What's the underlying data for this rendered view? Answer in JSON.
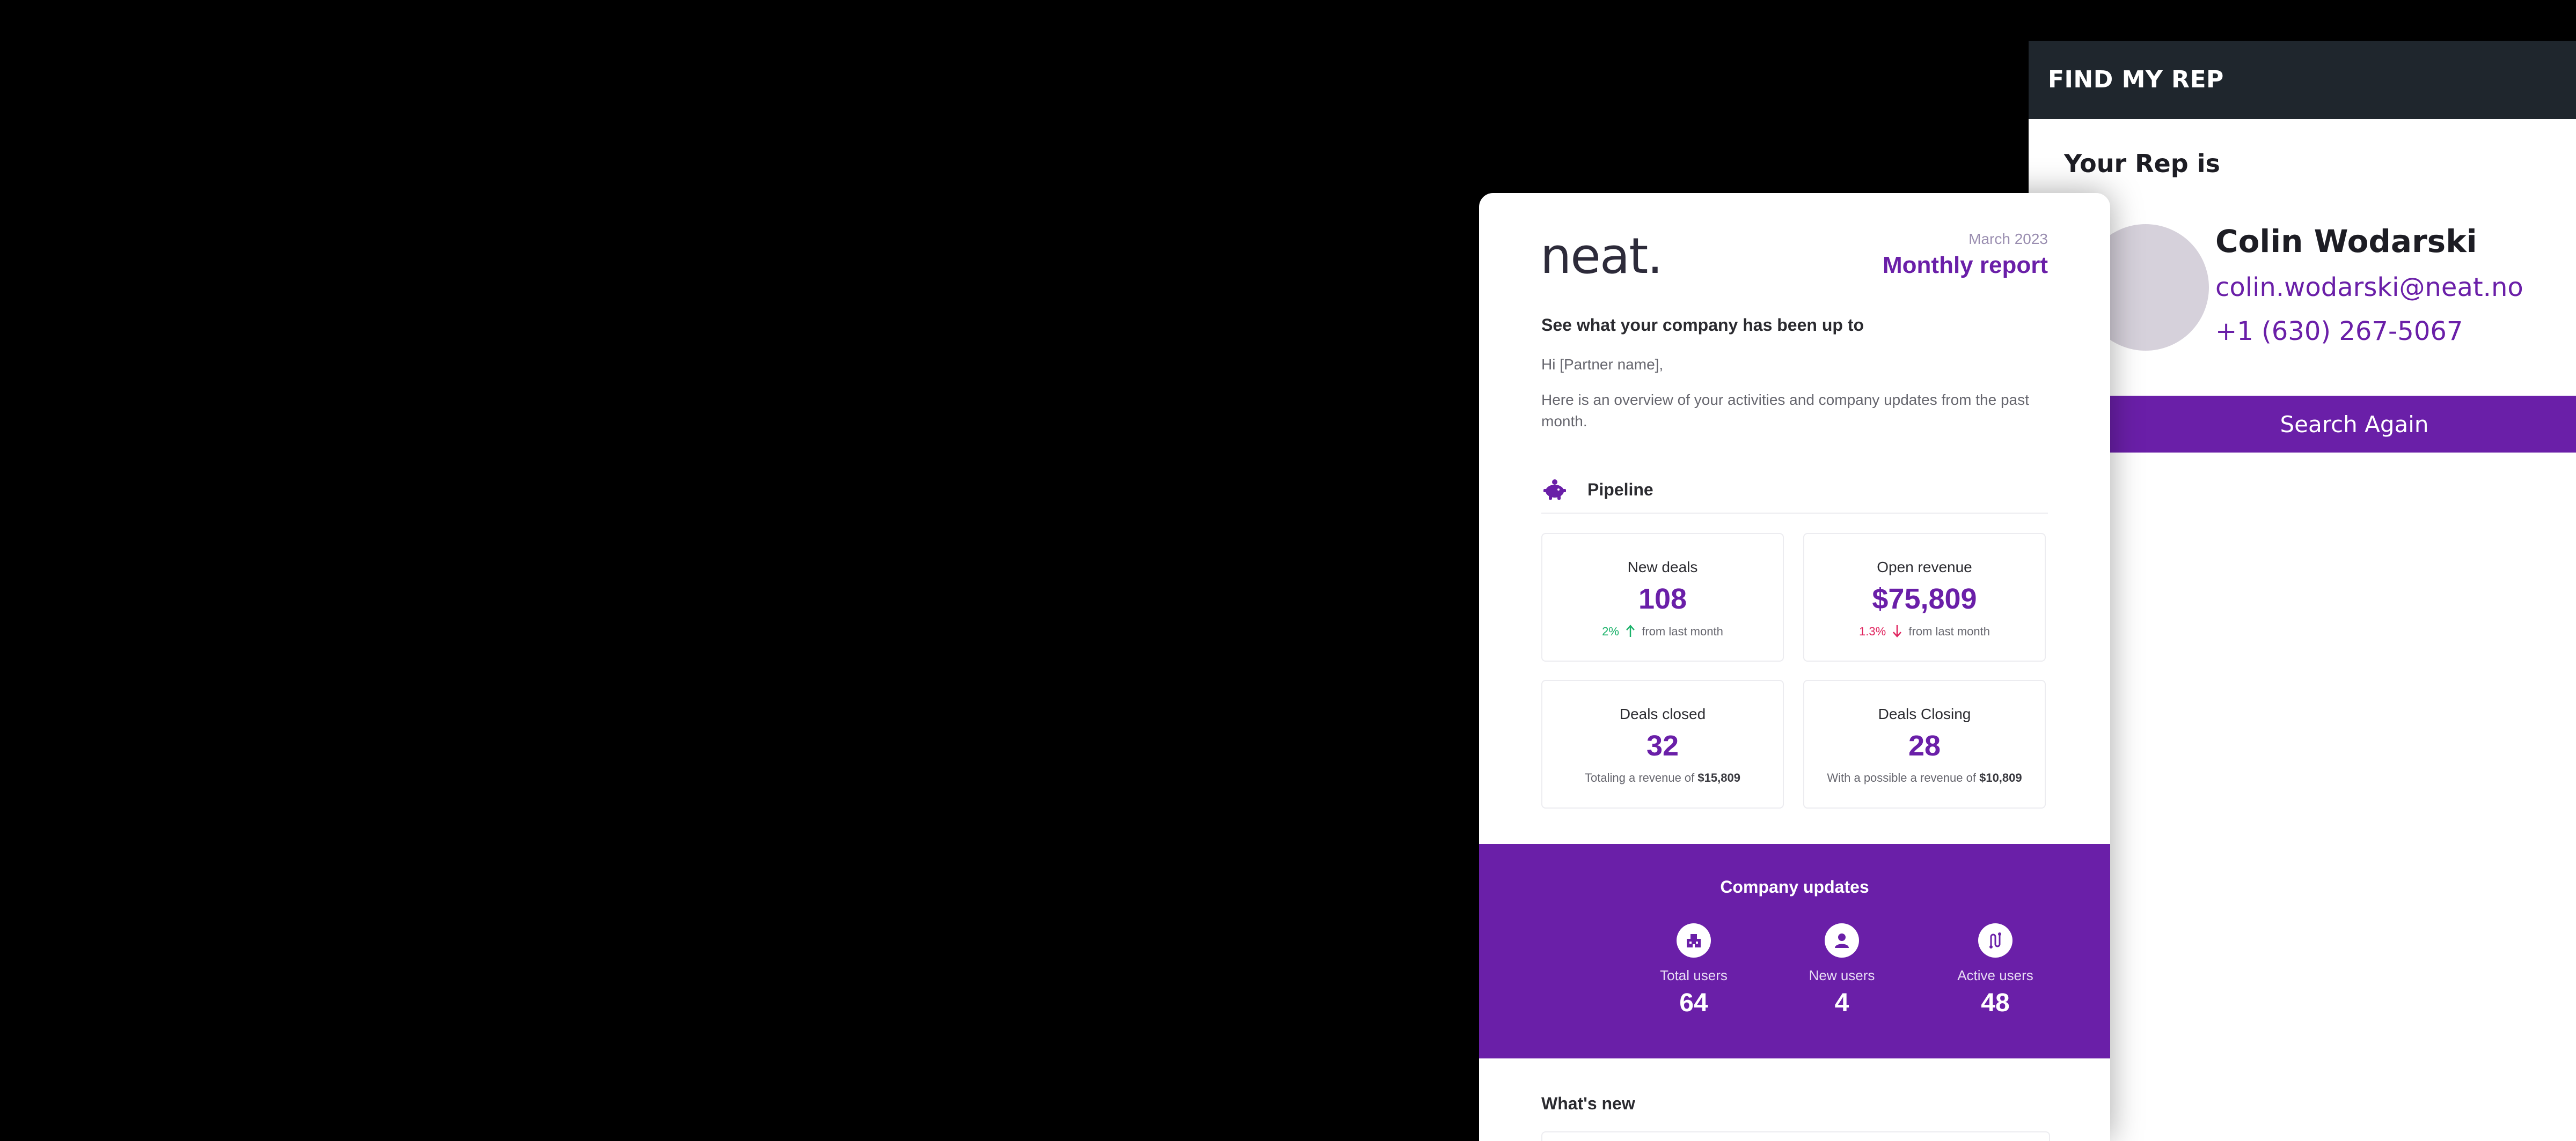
{
  "rep_panel": {
    "header": "FIND MY REP",
    "intro": "Your Rep is",
    "name": "Colin Wodarski",
    "email": "colin.wodarski@neat.no",
    "phone": "+1 (630) 267-5067",
    "button": "Search Again"
  },
  "report": {
    "logo_text": "neat.",
    "date": "March 2023",
    "title": "Monthly report",
    "heading": "See what your company has been up to",
    "greeting": "Hi [Partner name],",
    "overview": "Here is an overview of your activities and company updates from the past month.",
    "pipeline": {
      "label": "Pipeline",
      "icon": "piggy-bank-icon",
      "cards": [
        {
          "label": "New deals",
          "value": "108",
          "pct": "2%",
          "trend": "up",
          "suffix": "from last month"
        },
        {
          "label": "Open revenue",
          "value": "$75,809",
          "pct": "1.3%",
          "trend": "down",
          "suffix": "from last month"
        },
        {
          "label": "Deals closed",
          "value": "32",
          "sub_prefix": "Totaling a revenue of",
          "sub_amount": "$15,809"
        },
        {
          "label": "Deals Closing",
          "value": "28",
          "sub_prefix": "With a possible a revenue of",
          "sub_amount": "$10,809"
        }
      ]
    },
    "company_updates": {
      "title": "Company updates",
      "metrics": [
        {
          "label": "Total users",
          "value": "64",
          "icon": "building-icon"
        },
        {
          "label": "New users",
          "value": "4",
          "icon": "user-icon"
        },
        {
          "label": "Active users",
          "value": "48",
          "icon": "activity-icon"
        }
      ]
    },
    "whats_new": "What's new"
  },
  "colors": {
    "accent": "#6a1fa8",
    "header_dark": "#1f262d",
    "trend_up": "#1bb26a",
    "trend_down": "#e0245e"
  }
}
